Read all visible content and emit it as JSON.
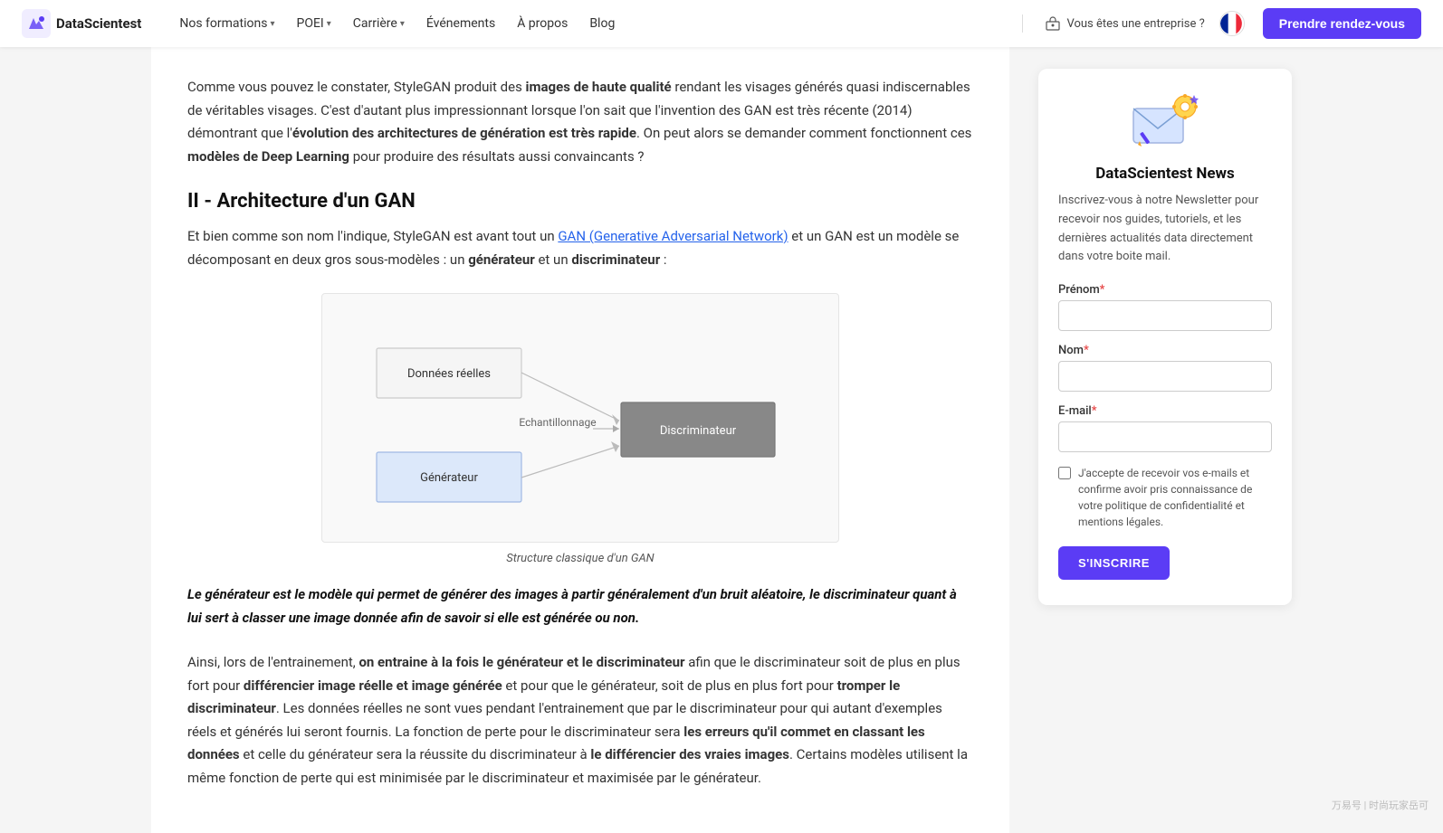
{
  "navbar": {
    "logo_text": "DataScientest",
    "nav_items": [
      {
        "label": "Nos formations",
        "has_chevron": true
      },
      {
        "label": "POEI",
        "has_chevron": true
      },
      {
        "label": "Carrière",
        "has_chevron": true
      },
      {
        "label": "Événements",
        "has_chevron": false
      },
      {
        "label": "À propos",
        "has_chevron": false
      },
      {
        "label": "Blog",
        "has_chevron": false
      }
    ],
    "enterprise_label": "Vous êtes une entreprise ?",
    "cta_label": "Prendre rendez-vous"
  },
  "main": {
    "intro_para_1": "Comme vous pouvez le constater, StyleGAN produit des ",
    "intro_bold_1": "images de haute qualité",
    "intro_para_2": " rendant les visages générés quasi indiscernables de véritables visages. C'est d'autant plus impressionnant lorsque l'on sait que l'invention des GAN est très récente (2014) démontrant que l'",
    "intro_bold_2": "évolution des architectures de génération est très rapide",
    "intro_para_3": ". On peut alors se demander comment fonctionnent ces ",
    "intro_bold_3": "modèles de Deep Learning",
    "intro_para_4": " pour produire des résultats aussi convaincants ?",
    "section_heading": "II - Architecture d'un GAN",
    "section_para_1": "Et bien comme son nom l'indique, StyleGAN est avant tout un ",
    "section_link": "GAN (Generative Adversarial Network)",
    "section_para_2": " et un GAN est un modèle se décomposant en deux gros sous-modèles : un ",
    "section_bold_1": "générateur",
    "section_para_3": " et un ",
    "section_bold_2": "discriminateur",
    "section_para_4": " :",
    "diagram_label_donnees": "Données réelles",
    "diagram_label_echantillonnage": "Echantillonnage",
    "diagram_label_discriminateur": "Discriminateur",
    "diagram_label_generateur": "Générateur",
    "diagram_caption": "Structure classique d'un GAN",
    "blockquote": "Le générateur est le modèle qui permet de générer des images à partir généralement d'un bruit aléatoire, le discriminateur quant à lui sert à classer une image donnée afin de savoir si elle est générée ou non.",
    "bottom_para_1": "Ainsi, lors de l'entrainement, ",
    "bottom_bold_1": "on entraine à la fois le générateur et le discriminateur",
    "bottom_para_2": " afin que le discriminateur soit de plus en plus fort pour ",
    "bottom_bold_2": "différencier image réelle et image générée",
    "bottom_para_3": " et pour que le générateur, soit de plus en plus fort pour ",
    "bottom_bold_3": "tromper le discriminateur",
    "bottom_para_4": ". Les données réelles ne sont vues pendant l'entrainement que par le discriminateur pour qui autant d'exemples réels et générés lui seront fournis. La fonction de perte pour le discriminateur sera ",
    "bottom_bold_4": "les erreurs qu'il commet en classant les données",
    "bottom_para_5": " et celle du générateur sera la réussite du discriminateur à ",
    "bottom_bold_5": "le différencier des vraies images",
    "bottom_para_6": ". Certains modèles utilisent la même fonction de perte qui est minimisée par le discriminateur et maximisée par le générateur."
  },
  "sidebar": {
    "news_title": "DataScientest News",
    "news_desc": "Inscrivez-vous à notre Newsletter pour recevoir nos guides, tutoriels, et les dernières actualités data directement dans votre boite mail.",
    "prenom_label": "Prénom",
    "nom_label": "Nom",
    "email_label": "E-mail",
    "checkbox_text": "J'accepte de recevoir vos e-mails et confirme avoir pris connaissance de votre politique de confidentialité et mentions légales.",
    "subscribe_label": "S'INSCRIRE"
  },
  "watermark": "万易号 | 时尚玩家岳可"
}
